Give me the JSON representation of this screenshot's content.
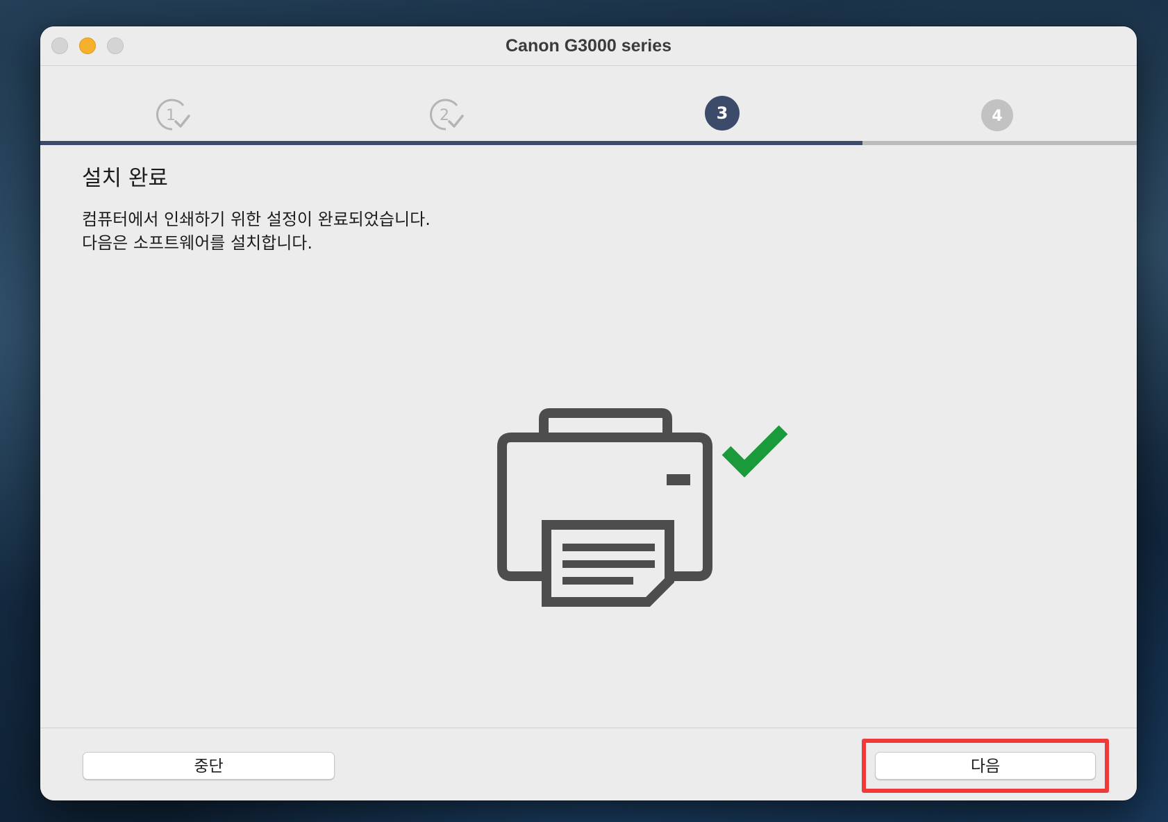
{
  "window": {
    "title": "Canon G3000 series"
  },
  "steps": {
    "items": [
      {
        "label": "1",
        "state": "completed"
      },
      {
        "label": "2",
        "state": "completed"
      },
      {
        "label": "3",
        "state": "current"
      },
      {
        "label": "4",
        "state": "pending"
      }
    ],
    "progress_fraction": 0.75
  },
  "main": {
    "heading": "설치 완료",
    "description_line1": "컴퓨터에서 인쇄하기 위한 설정이 완료되었습니다.",
    "description_line2": "다음은 소프트웨어를 설치합니다.",
    "illustration_icon": "printer-with-checkmark-icon"
  },
  "footer": {
    "cancel_label": "중단",
    "next_label": "다음"
  },
  "colors": {
    "accent": "#3d4b6a",
    "check_green": "#1a9a3a",
    "highlight_red": "#f03a3a",
    "minimize_yellow": "#f6b12c"
  }
}
